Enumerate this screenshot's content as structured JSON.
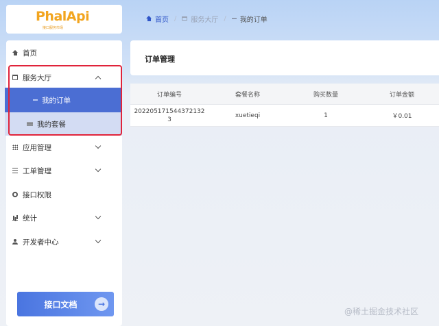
{
  "logo": {
    "text": "PhalApi",
    "subtitle": "接口服务市场"
  },
  "breadcrumb": {
    "home": "首页",
    "service_hall": "服务大厅",
    "current": "我的订单",
    "separator": "/"
  },
  "sidebar": {
    "items": [
      {
        "label": "首页",
        "icon": "home-icon"
      },
      {
        "label": "服务大厅",
        "icon": "cart-icon",
        "expanded": true
      },
      {
        "label": "应用管理",
        "icon": "grid-icon"
      },
      {
        "label": "工单管理",
        "icon": "list-icon"
      },
      {
        "label": "接口权限",
        "icon": "gear-icon"
      },
      {
        "label": "统计",
        "icon": "bar-chart-icon"
      },
      {
        "label": "开发者中心",
        "icon": "user-icon"
      }
    ],
    "sub_items": [
      {
        "label": "我的订单",
        "active": true
      },
      {
        "label": "我的套餐"
      }
    ],
    "doc_button": "接口文档",
    "doc_button_arrow": "→"
  },
  "content": {
    "title": "订单管理",
    "table": {
      "headers": [
        "订单编号",
        "套餐名称",
        "购买数量",
        "订单金额"
      ],
      "rows": [
        {
          "order_no": "202205171544372132\n3",
          "package": "xuetieqi",
          "quantity": "1",
          "amount": "￥0.01"
        }
      ]
    }
  },
  "watermark": "@稀土掘金技术社区",
  "colors": {
    "accent": "#4b6ed3",
    "highlight_box": "#e0233a",
    "price": "#e01b1b",
    "logo": "#f2a51f"
  }
}
